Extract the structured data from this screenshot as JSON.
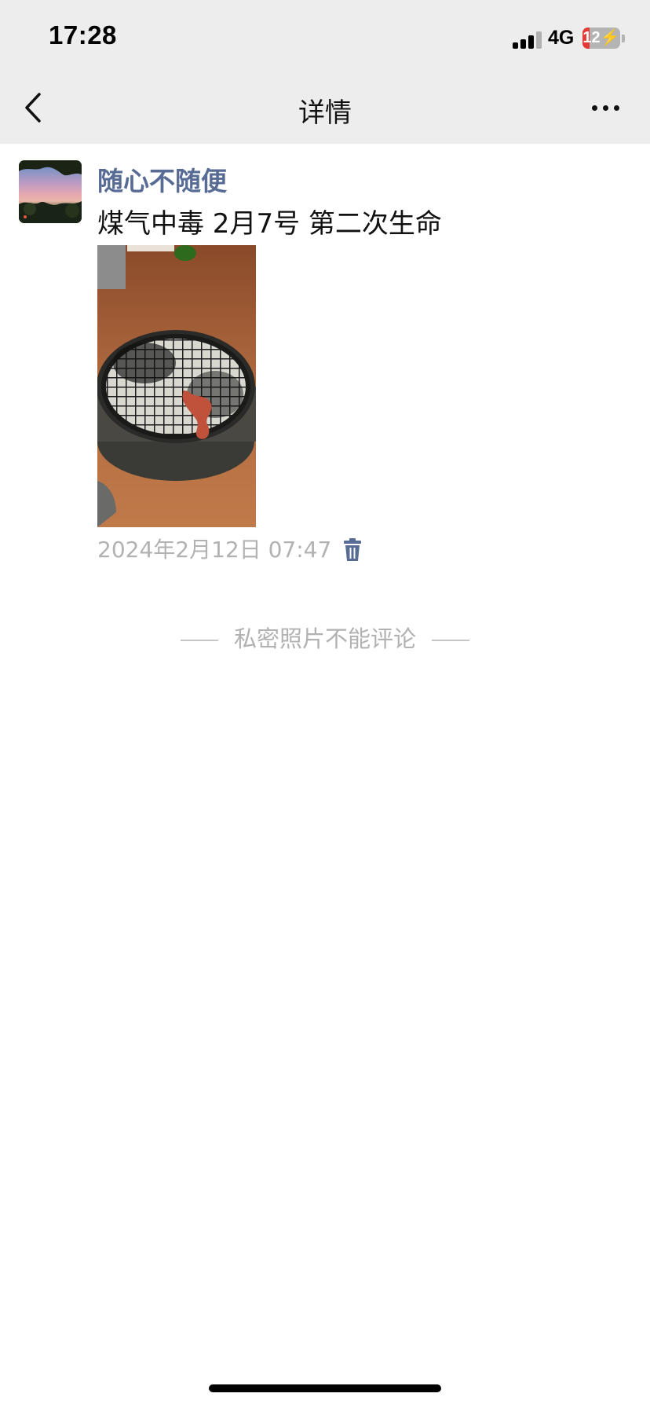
{
  "status_bar": {
    "time": "17:28",
    "network": "4G",
    "battery_level": 12,
    "battery_text": "12"
  },
  "nav": {
    "title": "详情",
    "back_icon": "chevron-left-icon",
    "more_icon": "more-dots-icon"
  },
  "post": {
    "username": "随心不随便",
    "text": "煤气中毒 2月7号 第二次生命",
    "timestamp": "2024年2月12日 07:47",
    "delete_icon": "trash-icon"
  },
  "footer_note": "私密照片不能评论",
  "colors": {
    "header_bg": "#ededed",
    "username": "#576b95",
    "muted_text": "#b2b2b2",
    "battery_low": "#e53935"
  }
}
